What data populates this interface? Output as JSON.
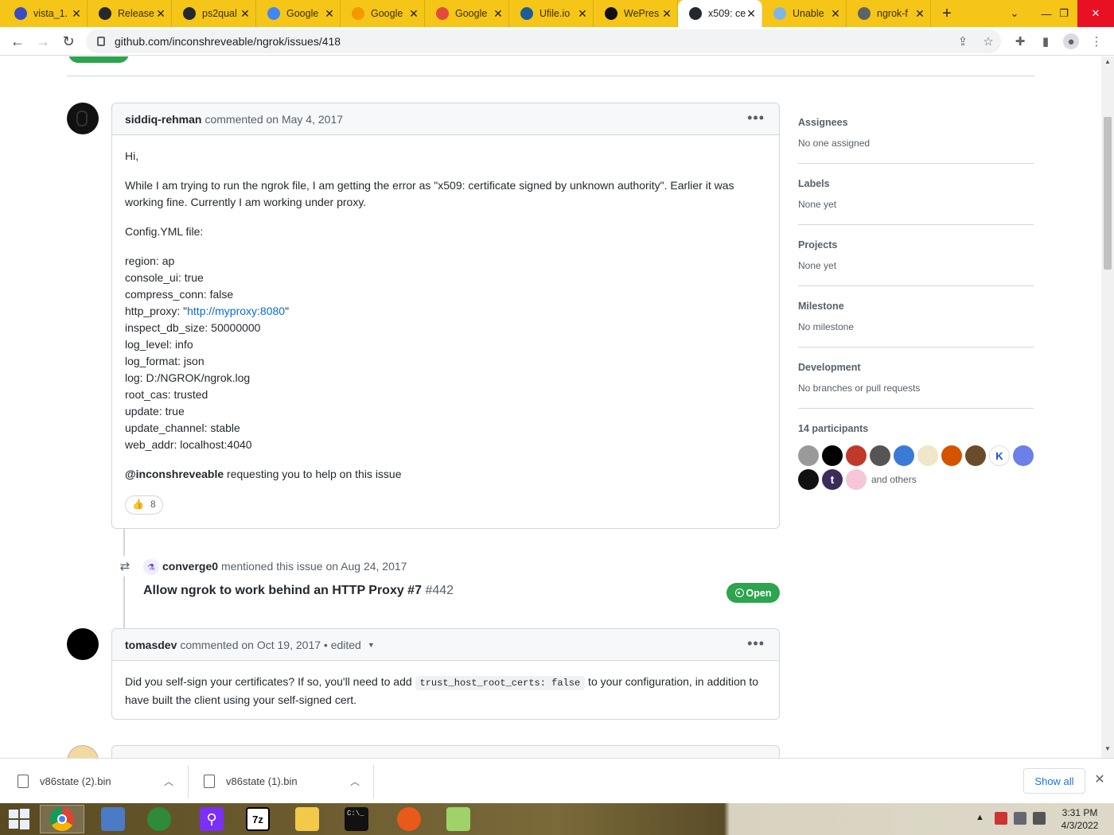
{
  "browser": {
    "tabs": [
      {
        "title": "vista_1.",
        "icon": "vista-icon",
        "color": "#3b4cc0"
      },
      {
        "title": "Release",
        "icon": "github-icon",
        "color": "#24292f"
      },
      {
        "title": "ps2qual",
        "icon": "github-icon",
        "color": "#24292f"
      },
      {
        "title": "Google",
        "icon": "google-icon",
        "color": "#4285f4"
      },
      {
        "title": "Google",
        "icon": "link-icon",
        "color": "#f29900"
      },
      {
        "title": "Google",
        "icon": "rainbow-icon",
        "color": "#e24a3b"
      },
      {
        "title": "Ufile.io",
        "icon": "ufile-icon",
        "color": "#1c5d99"
      },
      {
        "title": "WePres",
        "icon": "we-icon",
        "color": "#111111"
      },
      {
        "title": "x509: ce",
        "icon": "github-icon",
        "color": "#24292f"
      },
      {
        "title": "Unable",
        "icon": "page-icon",
        "color": "#7fb6e6"
      },
      {
        "title": "ngrok-f",
        "icon": "globe-icon",
        "color": "#5f6368"
      }
    ],
    "url": "github.com/inconshreveable/ngrok/issues/418"
  },
  "comments": [
    {
      "author": "siddiq-rehman",
      "meta": "commented on May 4, 2017",
      "greeting": "Hi,",
      "para1": "While I am trying to run the ngrok file, I am getting the error as \"x509: certificate signed by unknown authority\". Earlier it was working fine. Currently I am working under proxy.",
      "config_label": "Config.YML file:",
      "config_lines": {
        "l1": "region: ap",
        "l2": "console_ui: true",
        "l3": "compress_conn: false",
        "l4_pre": "http_proxy: \"",
        "l4_link": "http://myproxy:8080",
        "l4_post": "\"",
        "l5": "inspect_db_size: 50000000",
        "l6": "log_level: info",
        "l7": "log_format: json",
        "l8": "log: D:/NGROK/ngrok.log",
        "l9": "root_cas: trusted",
        "l10": "update: true",
        "l11": "update_channel: stable",
        "l12": "web_addr: localhost:4040"
      },
      "mention": "@inconshreveable",
      "mention_rest": " requesting you to help on this issue",
      "reaction_count": "8"
    },
    {
      "author": "tomasdev",
      "meta": "commented on Oct 19, 2017 • edited",
      "text_pre": "Did you self-sign your certificates? If so, you'll need to add ",
      "code": "trust_host_root_certs: false",
      "text_post": " to your configuration, in addition to have built the client using your self-signed cert."
    }
  ],
  "mention_event": {
    "user": "converge0",
    "meta": "mentioned this issue on Aug 24, 2017",
    "issue_title": "Allow ngrok to work behind an HTTP Proxy #7",
    "issue_number": "#442",
    "status": "Open",
    "status_color": "#2da44e"
  },
  "sidebar": {
    "assignees": {
      "title": "Assignees",
      "value": "No one assigned"
    },
    "labels": {
      "title": "Labels",
      "value": "None yet"
    },
    "projects": {
      "title": "Projects",
      "value": "None yet"
    },
    "milestone": {
      "title": "Milestone",
      "value": "No milestone"
    },
    "development": {
      "title": "Development",
      "value": "No branches or pull requests"
    },
    "participants": {
      "title": "14 participants",
      "others": "and others"
    }
  },
  "downloads": {
    "items": [
      "v86state (2).bin",
      "v86state (1).bin"
    ],
    "show_all": "Show all"
  },
  "taskbar": {
    "time": "3:31 PM",
    "date": "4/3/2022"
  }
}
